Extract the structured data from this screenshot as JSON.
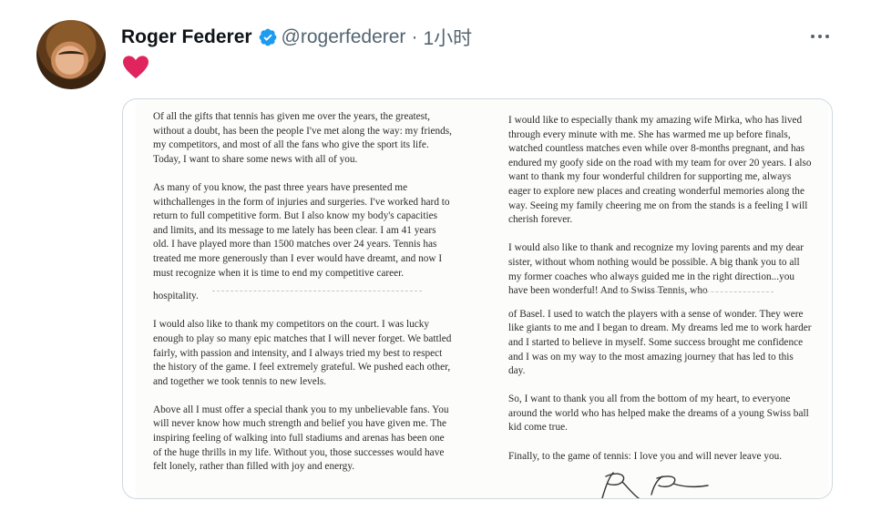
{
  "tweet": {
    "author_name": "Roger Federer",
    "handle": "@rogerfederer",
    "separator": "·",
    "time": "1小时",
    "colors": {
      "verified": "#1d9bf0",
      "heart": "#e0245e"
    }
  },
  "letter": {
    "left": [
      "Of all the gifts that tennis has given me over the years, the greatest, without a doubt, has been the people I've met along the way: my friends, my competitors, and most of all the fans who give the sport its life. Today, I want to share some news with all of you.",
      "As many of you know, the past three years have presented me withchallenges in the form of injuries and surgeries. I've worked hard to return to full competitive form. But I also know my body's capacities and limits, and its message to me lately has been clear. I am 41 years old. I have played more than 1500 matches over 24 years. Tennis has treated me more generously than I ever would have dreamt, and now I must recognize when it is time to end my competitive career.",
      "hospitality.",
      "I would also like to thank my competitors on the court. I was lucky enough to play so many epic matches that I will never forget. We battled fairly, with passion and intensity, and I always tried my best to respect the history of the game. I feel extremely grateful. We pushed each other, and together we took tennis to new levels.",
      "Above all I must offer a special thank you to my unbelievable fans. You will never know how much strength and belief you have given me. The inspiring feeling of walking into full stadiums and arenas has been one of the huge thrills in my life. Without you, those successes would have felt lonely, rather than filled with joy and energy."
    ],
    "right": [
      "I would like to especially thank my amazing wife Mirka, who has lived through every minute with me. She has warmed me up before finals, watched countless matches even while over 8-months pregnant, and has endured my goofy side on the road with my team for over 20 years. I also want to thank my four wonderful children for supporting me, always eager to explore new places and creating wonderful memories along the way. Seeing my family cheering me on from the stands is a feeling I will cherish forever.",
      "I would also like to thank and recognize my loving parents and my dear sister, without whom nothing would be possible. A big thank you to all my former coaches who always guided me in the right direction...you have been wonderful! And to Swiss Tennis, who",
      "of Basel. I used to watch the players with a sense of wonder. They were like giants to me and I began to dream. My dreams led me to work harder and I started to believe in myself. Some success brought me confidence and I was on my way to the most amazing journey that has led to this day.",
      "So, I want to thank you all from the bottom of my heart, to everyone around the world who has helped make the dreams of a young Swiss ball kid come true.",
      "Finally, to the game of tennis: I love you and will never leave you."
    ]
  }
}
